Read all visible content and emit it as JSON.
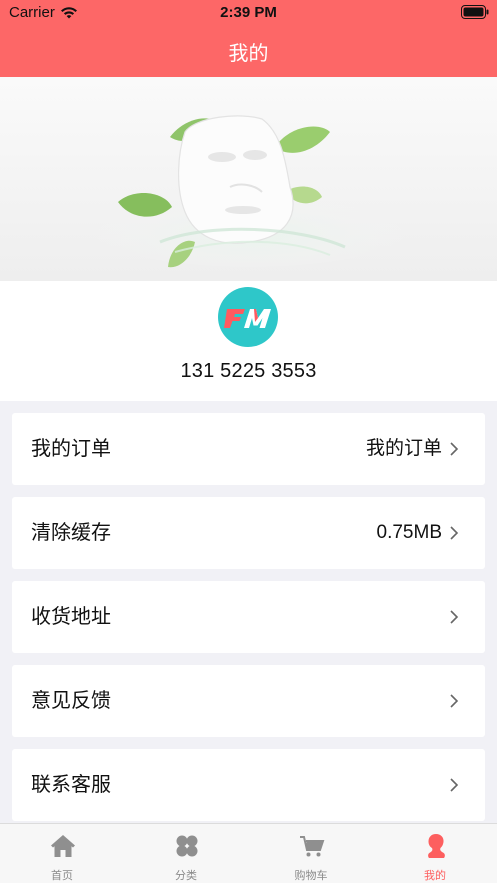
{
  "status_bar": {
    "carrier": "Carrier",
    "time": "2:39 PM",
    "icons": [
      "wifi-icon",
      "battery-icon"
    ]
  },
  "nav": {
    "title": "我的"
  },
  "banner": {
    "image": "face-mask-with-leaves-illustration"
  },
  "profile": {
    "avatar_logo": "FM",
    "phone": "131 5225 3553"
  },
  "menu": [
    {
      "label": "我的订单",
      "value": "我的订单",
      "icon": "chevron-right-icon"
    },
    {
      "label": "清除缓存",
      "value": "0.75MB",
      "icon": "chevron-right-icon"
    },
    {
      "label": "收货地址",
      "value": "",
      "icon": "chevron-right-icon"
    },
    {
      "label": "意见反馈",
      "value": "",
      "icon": "chevron-right-icon"
    },
    {
      "label": "联系客服",
      "value": "",
      "icon": "chevron-right-icon"
    }
  ],
  "tabbar": {
    "tabs": [
      {
        "label": "首页",
        "icon": "home-icon",
        "active": false
      },
      {
        "label": "分类",
        "icon": "category-icon",
        "active": false
      },
      {
        "label": "购物车",
        "icon": "cart-icon",
        "active": false
      },
      {
        "label": "我的",
        "icon": "profile-icon",
        "active": true
      }
    ]
  },
  "colors": {
    "accent": "#fd6767",
    "active_tab": "#fd5f5f",
    "avatar_bg": "#2ec7c9",
    "page_bg": "#f1f1f6"
  }
}
